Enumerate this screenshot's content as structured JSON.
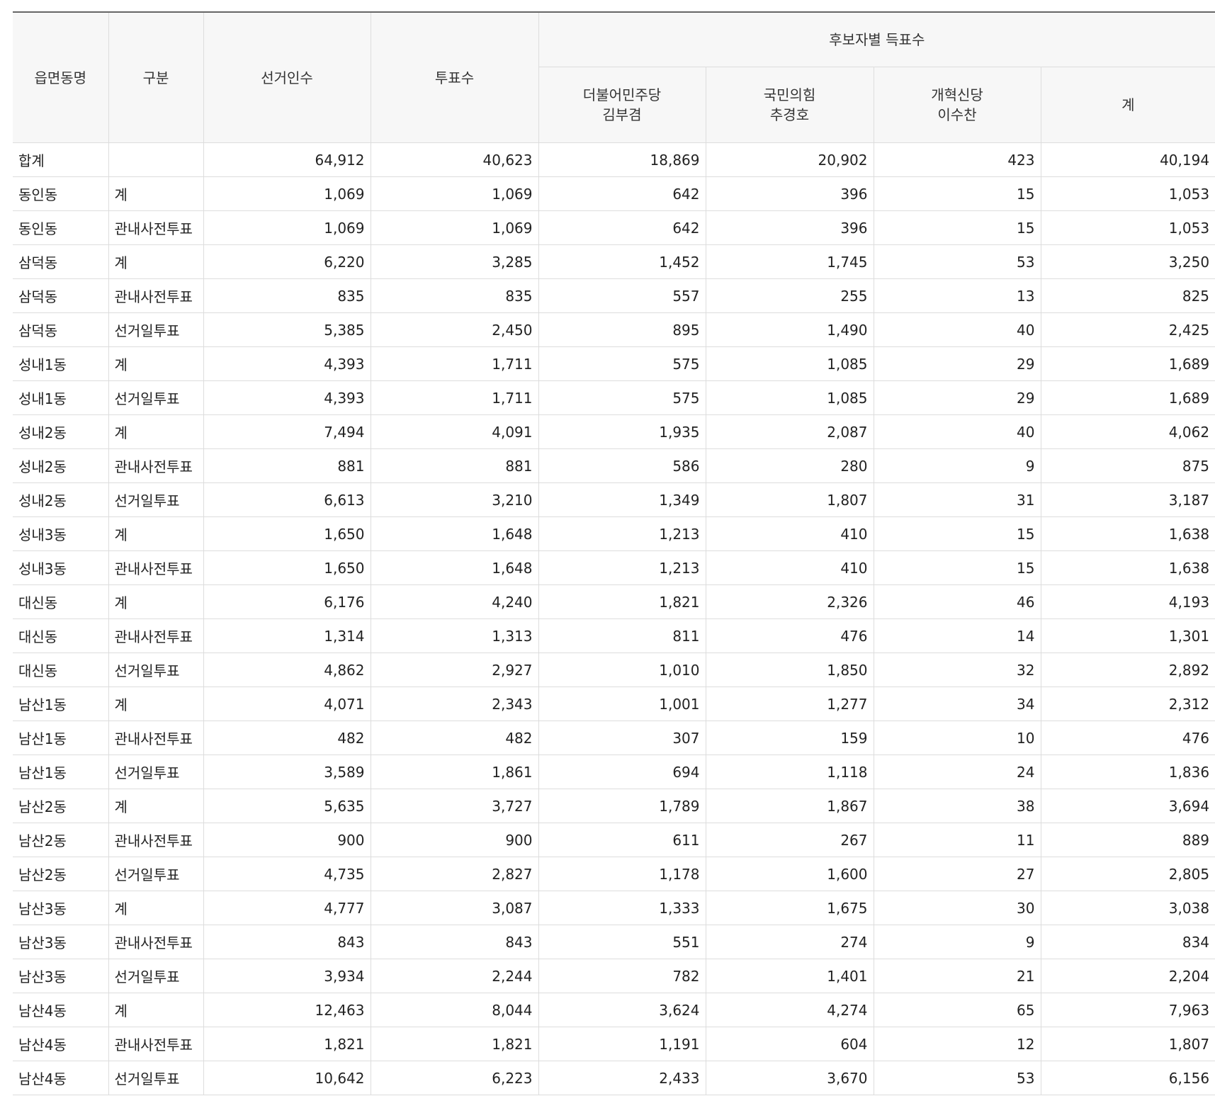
{
  "table": {
    "headers": {
      "district": "읍면동명",
      "category": "구분",
      "electorate": "선거인수",
      "turnout": "투표수",
      "candidates_group": "후보자별 득표수",
      "candidates": [
        {
          "party": "더불어민주당",
          "name": "김부겸"
        },
        {
          "party": "국민의힘",
          "name": "추경호"
        },
        {
          "party": "개혁신당",
          "name": "이수찬"
        }
      ],
      "total": "계"
    },
    "rows": [
      [
        "합계",
        "",
        "64,912",
        "40,623",
        "18,869",
        "20,902",
        "423",
        "40,194"
      ],
      [
        "동인동",
        "계",
        "1,069",
        "1,069",
        "642",
        "396",
        "15",
        "1,053"
      ],
      [
        "동인동",
        "관내사전투표",
        "1,069",
        "1,069",
        "642",
        "396",
        "15",
        "1,053"
      ],
      [
        "삼덕동",
        "계",
        "6,220",
        "3,285",
        "1,452",
        "1,745",
        "53",
        "3,250"
      ],
      [
        "삼덕동",
        "관내사전투표",
        "835",
        "835",
        "557",
        "255",
        "13",
        "825"
      ],
      [
        "삼덕동",
        "선거일투표",
        "5,385",
        "2,450",
        "895",
        "1,490",
        "40",
        "2,425"
      ],
      [
        "성내1동",
        "계",
        "4,393",
        "1,711",
        "575",
        "1,085",
        "29",
        "1,689"
      ],
      [
        "성내1동",
        "선거일투표",
        "4,393",
        "1,711",
        "575",
        "1,085",
        "29",
        "1,689"
      ],
      [
        "성내2동",
        "계",
        "7,494",
        "4,091",
        "1,935",
        "2,087",
        "40",
        "4,062"
      ],
      [
        "성내2동",
        "관내사전투표",
        "881",
        "881",
        "586",
        "280",
        "9",
        "875"
      ],
      [
        "성내2동",
        "선거일투표",
        "6,613",
        "3,210",
        "1,349",
        "1,807",
        "31",
        "3,187"
      ],
      [
        "성내3동",
        "계",
        "1,650",
        "1,648",
        "1,213",
        "410",
        "15",
        "1,638"
      ],
      [
        "성내3동",
        "관내사전투표",
        "1,650",
        "1,648",
        "1,213",
        "410",
        "15",
        "1,638"
      ],
      [
        "대신동",
        "계",
        "6,176",
        "4,240",
        "1,821",
        "2,326",
        "46",
        "4,193"
      ],
      [
        "대신동",
        "관내사전투표",
        "1,314",
        "1,313",
        "811",
        "476",
        "14",
        "1,301"
      ],
      [
        "대신동",
        "선거일투표",
        "4,862",
        "2,927",
        "1,010",
        "1,850",
        "32",
        "2,892"
      ],
      [
        "남산1동",
        "계",
        "4,071",
        "2,343",
        "1,001",
        "1,277",
        "34",
        "2,312"
      ],
      [
        "남산1동",
        "관내사전투표",
        "482",
        "482",
        "307",
        "159",
        "10",
        "476"
      ],
      [
        "남산1동",
        "선거일투표",
        "3,589",
        "1,861",
        "694",
        "1,118",
        "24",
        "1,836"
      ],
      [
        "남산2동",
        "계",
        "5,635",
        "3,727",
        "1,789",
        "1,867",
        "38",
        "3,694"
      ],
      [
        "남산2동",
        "관내사전투표",
        "900",
        "900",
        "611",
        "267",
        "11",
        "889"
      ],
      [
        "남산2동",
        "선거일투표",
        "4,735",
        "2,827",
        "1,178",
        "1,600",
        "27",
        "2,805"
      ],
      [
        "남산3동",
        "계",
        "4,777",
        "3,087",
        "1,333",
        "1,675",
        "30",
        "3,038"
      ],
      [
        "남산3동",
        "관내사전투표",
        "843",
        "843",
        "551",
        "274",
        "9",
        "834"
      ],
      [
        "남산3동",
        "선거일투표",
        "3,934",
        "2,244",
        "782",
        "1,401",
        "21",
        "2,204"
      ],
      [
        "남산4동",
        "계",
        "12,463",
        "8,044",
        "3,624",
        "4,274",
        "65",
        "7,963"
      ],
      [
        "남산4동",
        "관내사전투표",
        "1,821",
        "1,821",
        "1,191",
        "604",
        "12",
        "1,807"
      ],
      [
        "남산4동",
        "선거일투표",
        "10,642",
        "6,223",
        "2,433",
        "3,670",
        "53",
        "6,156"
      ]
    ]
  }
}
